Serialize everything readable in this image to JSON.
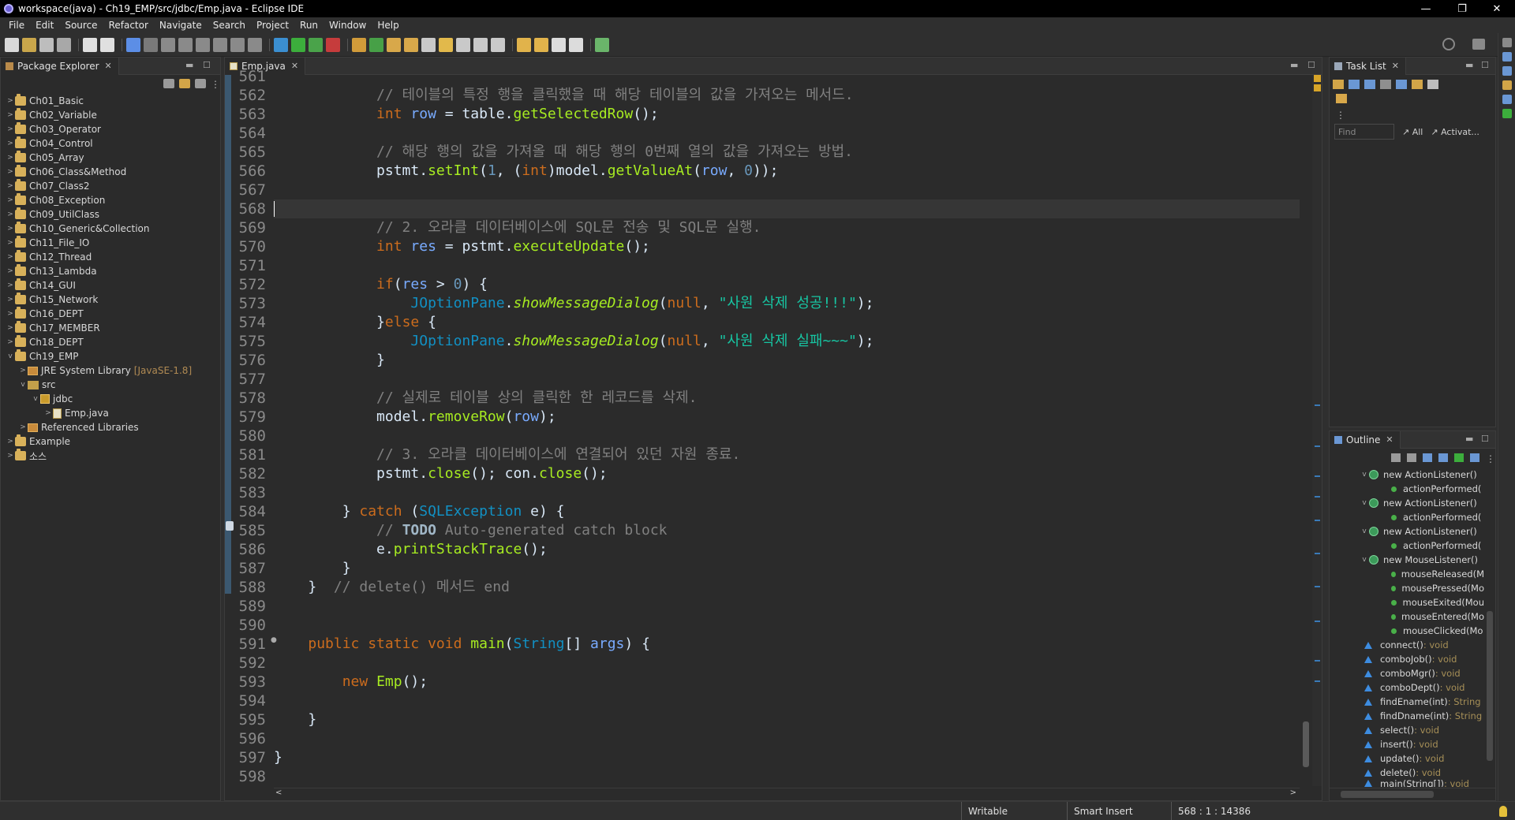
{
  "window": {
    "title": "workspace(java) - Ch19_EMP/src/jdbc/Emp.java - Eclipse IDE",
    "minimize": "—",
    "maximize": "❐",
    "close": "✕"
  },
  "menu": [
    "File",
    "Edit",
    "Source",
    "Refactor",
    "Navigate",
    "Search",
    "Project",
    "Run",
    "Window",
    "Help"
  ],
  "package_explorer": {
    "title": "Package Explorer",
    "projects": [
      "Ch01_Basic",
      "Ch02_Variable",
      "Ch03_Operator",
      "Ch04_Control",
      "Ch05_Array",
      "Ch06_Class&Method",
      "Ch07_Class2",
      "Ch08_Exception",
      "Ch09_UtilClass",
      "Ch10_Generic&Collection",
      "Ch11_File_IO",
      "Ch12_Thread",
      "Ch13_Lambda",
      "Ch14_GUI",
      "Ch15_Network",
      "Ch16_DEPT",
      "Ch17_MEMBER",
      "Ch18_DEPT",
      "Ch19_EMP"
    ],
    "jre": "JRE System Library",
    "jre_version": "[JavaSE-1.8]",
    "src": "src",
    "pkg": "jdbc",
    "file": "Emp.java",
    "ref_libs": "Referenced Libraries",
    "extra_projects": [
      "Example",
      "소스"
    ]
  },
  "editor": {
    "tab": "Emp.java",
    "lines": [
      "561",
      "562",
      "563",
      "564",
      "565",
      "566",
      "567",
      "568",
      "569",
      "570",
      "571",
      "572",
      "573",
      "574",
      "575",
      "576",
      "577",
      "578",
      "579",
      "580",
      "581",
      "582",
      "583",
      "584",
      "585",
      "586",
      "587",
      "588",
      "589",
      "590",
      "591",
      "592",
      "593",
      "594",
      "595",
      "596",
      "597",
      "598"
    ],
    "code": {
      "c562": "// 테이블의 특정 행을 클릭했을 때 해당 테이블의 값을 가져오는 메서드.",
      "c565": "// 해당 행의 값을 가져올 때 해당 행의 0번째 열의 값을 가져오는 방법.",
      "c569": "// 2. 오라클 데이터베이스에 SQL문 전송 및 SQL문 실행.",
      "s573": "\"사원 삭제 성공!!!\"",
      "s575": "\"사원 삭제 실패~~~\"",
      "c578": "// 실제로 테이블 상의 클릭한 한 레코드를 삭제.",
      "c581": "// 3. 오라클 데이터베이스에 연결되어 있던 자원 종료.",
      "c585a": "// ",
      "c585b": "TODO",
      "c585c": " Auto-generated catch block",
      "c588": "// delete() 메서드 end"
    }
  },
  "task_list": {
    "title": "Task List",
    "find_placeholder": "Find",
    "all": "All",
    "activate": "Activat..."
  },
  "outline": {
    "title": "Outline",
    "items": [
      {
        "kind": "class",
        "text": "new ActionListener()"
      },
      {
        "kind": "method",
        "text": "actionPerformed("
      },
      {
        "kind": "class",
        "text": "new ActionListener()"
      },
      {
        "kind": "method",
        "text": "actionPerformed("
      },
      {
        "kind": "class",
        "text": "new ActionListener()"
      },
      {
        "kind": "method",
        "text": "actionPerformed("
      },
      {
        "kind": "class",
        "text": "new MouseListener()"
      },
      {
        "kind": "method",
        "text": "mouseReleased(M"
      },
      {
        "kind": "method",
        "text": "mousePressed(Mo"
      },
      {
        "kind": "method",
        "text": "mouseExited(Mou"
      },
      {
        "kind": "method",
        "text": "mouseEntered(Mo"
      },
      {
        "kind": "method",
        "text": "mouseClicked(Mo"
      }
    ],
    "members": [
      {
        "name": "connect()",
        "sig": " : void"
      },
      {
        "name": "comboJob()",
        "sig": " : void"
      },
      {
        "name": "comboMgr()",
        "sig": " : void"
      },
      {
        "name": "comboDept()",
        "sig": " : void"
      },
      {
        "name": "findEname(int)",
        "sig": " : String"
      },
      {
        "name": "findDname(int)",
        "sig": " : String"
      },
      {
        "name": "select()",
        "sig": " : void"
      },
      {
        "name": "insert()",
        "sig": " : void"
      },
      {
        "name": "update()",
        "sig": " : void"
      },
      {
        "name": "delete()",
        "sig": " : void"
      },
      {
        "name": "main(String[])",
        "sig": " : void"
      }
    ]
  },
  "status": {
    "writable": "Writable",
    "insert_mode": "Smart Insert",
    "position": "568 : 1 : 14386"
  }
}
